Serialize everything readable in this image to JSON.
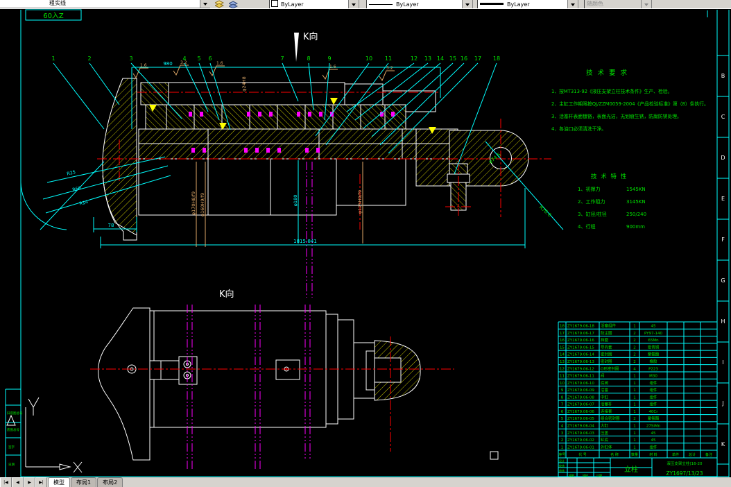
{
  "toolbar": {
    "layer_name": "粗实线",
    "color_value": "ByLayer",
    "linetype_value": "ByLayer",
    "lineweight_value": "ByLayer",
    "plotstyle_value": "随颜色",
    "accent_colors": {
      "toolbar_bg": "#d6d3ce",
      "canvas_bg": "#000000"
    }
  },
  "frame": {
    "top_note": "60入Z",
    "zone_letters": [
      "B",
      "C",
      "D",
      "E",
      "F",
      "G",
      "H",
      "I",
      "J",
      "K"
    ],
    "left_labels": [
      "旧底图总号",
      "底图总号",
      "签字",
      "日期"
    ],
    "axis_x_label": "X"
  },
  "drawing": {
    "k_arrow_label": "K向",
    "k_view_label": "K向",
    "callouts": [
      "1",
      "2",
      "3",
      "4",
      "5",
      "6",
      "7",
      "8",
      "9",
      "10",
      "11",
      "12",
      "13",
      "14",
      "15",
      "16",
      "17",
      "18"
    ],
    "dims": {
      "top": "980",
      "rod": "φ24H8",
      "d170": "φ170H8/f9",
      "d160": "φ160H9/f9",
      "d180": "φ180",
      "d125": "φ125H9/f9",
      "overall": "1815-841",
      "foot": "78",
      "r25": "R25",
      "r66": "R66",
      "r14": "R14",
      "eye_dia": "φ74.5",
      "eye_r": "R70.0"
    },
    "roughness": [
      "1.6",
      "3.2",
      "1.6",
      "1.6",
      "3.2"
    ],
    "colors": {
      "outline": "#ffffff",
      "hatch": "#d8d800",
      "centerline": "#ff0000",
      "dimension": "#00ffff",
      "dim_text": "#dfa868",
      "annotation": "#00e400",
      "seal": "#ff00ff"
    }
  },
  "tech_requirements": {
    "title": "技 术 要 求",
    "items": [
      "1、按MT313-92《液压支架立柱技术条件》生产、检验。",
      "2、主缸工作期限按QJ/ZZM0059-2004《产品检验标准》第（8）条执行。",
      "3、活塞杆表面镀铬，表面光洁，无划痕生锈，防腐防锈处理。",
      "4、各油口必须清洗干净。"
    ]
  },
  "tech_specs": {
    "title": "技 术 特 性",
    "rows": [
      {
        "label": "1、初撑力",
        "value": "1545KN"
      },
      {
        "label": "2、工作阻力",
        "value": "3145KN"
      },
      {
        "label": "3、缸径/柱径",
        "value": "250/240"
      },
      {
        "label": "4、行程",
        "value": "900mm"
      }
    ]
  },
  "bom": {
    "headers": {
      "no": "序号",
      "code": "代 号",
      "name": "名 称",
      "qty": "数量",
      "mat": "材 料",
      "unit": "单件",
      "total": "总计",
      "note": "备注"
    },
    "rows": [
      {
        "no": "18",
        "code": "ZY1679.06-18",
        "name": "活塞组件",
        "qty": "1",
        "mat": "45"
      },
      {
        "no": "17",
        "code": "ZY1679.06-17",
        "name": "防尘圈",
        "qty": "2",
        "mat": "PY97-140"
      },
      {
        "no": "16",
        "code": "ZY1679.06-16",
        "name": "挡圈",
        "qty": "2",
        "mat": "65Mn"
      },
      {
        "no": "15",
        "code": "ZY1679.06-15",
        "name": "导向套",
        "qty": "2",
        "mat": "铝青铜"
      },
      {
        "no": "14",
        "code": "ZY1679.06-14",
        "name": "密封圈",
        "qty": "2",
        "mat": "聚氨酯"
      },
      {
        "no": "13",
        "code": "ZY1679.06-13",
        "name": "密封圈",
        "qty": "2",
        "mat": "橡胶"
      },
      {
        "no": "12",
        "code": "ZY1679.06-12",
        "name": "O形密封圈",
        "qty": "4",
        "mat": "P223"
      },
      {
        "no": "11",
        "code": "ZY1679.06-11",
        "name": "阀",
        "qty": "1",
        "mat": "M30"
      },
      {
        "no": "10",
        "code": "ZY1679.06-10",
        "name": "底阀",
        "qty": "1",
        "mat": "组件"
      },
      {
        "no": "9",
        "code": "ZY1679.06-09",
        "name": "活塞",
        "qty": "1",
        "mat": "组件"
      },
      {
        "no": "8",
        "code": "ZY1679.06-08",
        "name": "中缸",
        "qty": "1",
        "mat": "组件"
      },
      {
        "no": "7",
        "code": "ZY1679.06-07",
        "name": "活塞杆",
        "qty": "1",
        "mat": "组件"
      },
      {
        "no": "6",
        "code": "ZY1679.06-06",
        "name": "连接套",
        "qty": "1",
        "mat": "40Cr"
      },
      {
        "no": "5",
        "code": "ZY1679.06-05",
        "name": "组合密封圈",
        "qty": "2",
        "mat": "聚氨酯"
      },
      {
        "no": "4",
        "code": "ZY1679.06-04",
        "name": "大缸",
        "qty": "1",
        "mat": "27SiMn"
      },
      {
        "no": "3",
        "code": "ZY1679.06-03",
        "name": "压盖",
        "qty": "1",
        "mat": "45"
      },
      {
        "no": "2",
        "code": "ZY1679.06-02",
        "name": "缸底",
        "qty": "1",
        "mat": "45"
      },
      {
        "no": "1",
        "code": "ZY1679.06-01",
        "name": "外缸体",
        "qty": "1",
        "mat": "组件"
      }
    ]
  },
  "title_block": {
    "product": "立柱",
    "spec": "液压支架立柱(16-20",
    "code": "ZY1697/13/23",
    "labels": [
      "设计",
      "校核",
      "审核",
      "描图",
      "描校",
      "日期"
    ]
  },
  "tabs": {
    "model": "模型",
    "layout1": "布局1",
    "layout2": "布局2"
  }
}
